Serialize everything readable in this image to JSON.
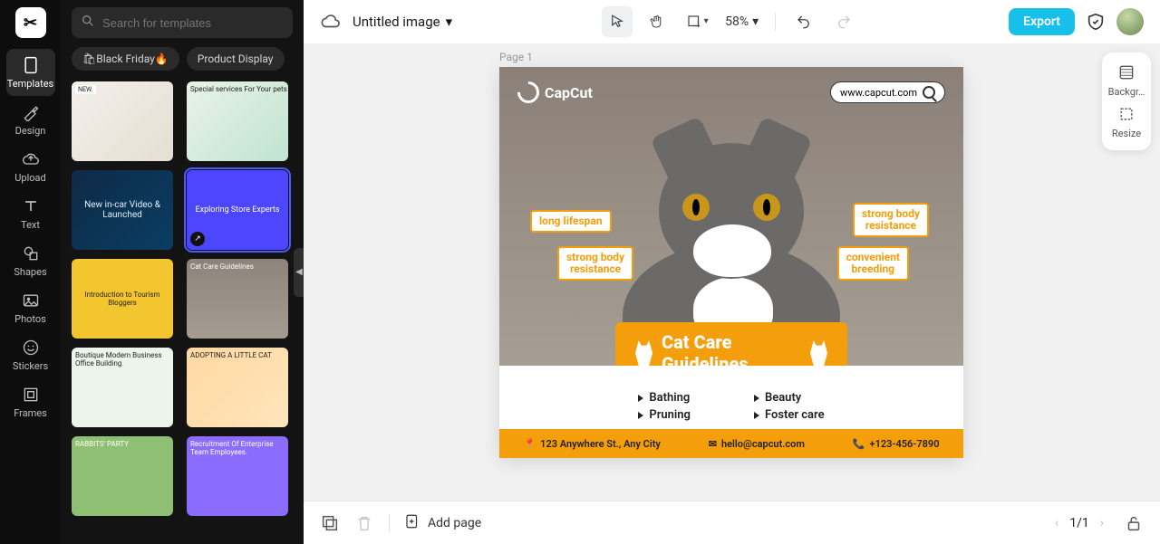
{
  "rail": {
    "items": [
      {
        "label": "Templates"
      },
      {
        "label": "Design"
      },
      {
        "label": "Upload"
      },
      {
        "label": "Text"
      },
      {
        "label": "Shapes"
      },
      {
        "label": "Photos"
      },
      {
        "label": "Stickers"
      },
      {
        "label": "Frames"
      }
    ]
  },
  "panel": {
    "search_placeholder": "Search for templates",
    "chips": [
      "🛍Black Friday🔥",
      "Product Display"
    ],
    "templates": [
      {
        "label": "NEW."
      },
      {
        "label": "Special services For Your pets"
      },
      {
        "label": "New in-car Video & Launched"
      },
      {
        "label": "Exploring Store Experts"
      },
      {
        "label": "Introduction to Tourism Bloggers"
      },
      {
        "label": "Cat Care Guidelines"
      },
      {
        "label": "Boutique Modern Business Office Building"
      },
      {
        "label": "ADOPTING A LITTLE CAT"
      },
      {
        "label": "RABBITS' PARTY"
      },
      {
        "label": "Recruitment Of Enterprise Team Employees."
      }
    ]
  },
  "topbar": {
    "title": "Untitled image",
    "zoom": "58%",
    "export_label": "Export"
  },
  "rtools": {
    "background_label": "Backgr…",
    "resize_label": "Resize"
  },
  "page_label": "Page 1",
  "doc": {
    "brand": "CapCut",
    "url": "www.capcut.com",
    "tags": {
      "t1": "long lifespan",
      "t2_l1": "strong body",
      "t2_l2": "resistance",
      "t3_l1": "strong body",
      "t3_l2": "resistance",
      "t4_l1": "convenient",
      "t4_l2": "breeding"
    },
    "banner": "Cat Care Guidelines",
    "bullets": {
      "c1r1": "Bathing",
      "c1r2": "Pruning",
      "c2r1": "Beauty",
      "c2r2": "Foster care"
    },
    "footer": {
      "addr": "123 Anywhere St., Any City",
      "email": "hello@capcut.com",
      "phone": "+123-456-7890"
    }
  },
  "bottombar": {
    "addpage_label": "Add page",
    "page_count": "1/1"
  }
}
